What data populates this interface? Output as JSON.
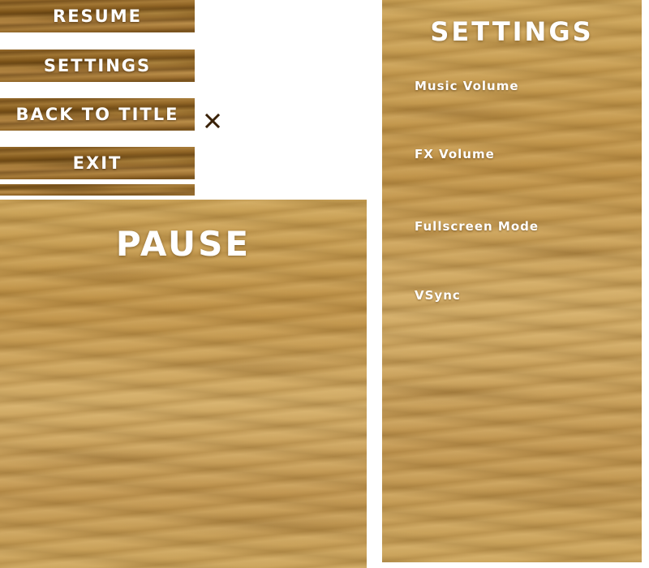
{
  "pause_menu": {
    "buttons": [
      {
        "id": "resume",
        "label": "RESUME"
      },
      {
        "id": "settings",
        "label": "SETTINGS"
      },
      {
        "id": "back_to_title",
        "label": "BACK TO TITLE"
      },
      {
        "id": "exit",
        "label": "EXIT"
      }
    ],
    "close_icon": "close-icon"
  },
  "pause_panel": {
    "title": "PAUSE"
  },
  "settings_panel": {
    "title": "SETTINGS",
    "options": [
      {
        "label": "Music Volume"
      },
      {
        "label": "FX Volume"
      },
      {
        "label": "Fullscreen Mode"
      },
      {
        "label": "VSync"
      }
    ]
  },
  "colors": {
    "wood_light": "#c49a4e",
    "wood_dark": "#8f6425",
    "text": "#ffffff",
    "close_icon": "#3a2208",
    "background": "#ffffff"
  }
}
